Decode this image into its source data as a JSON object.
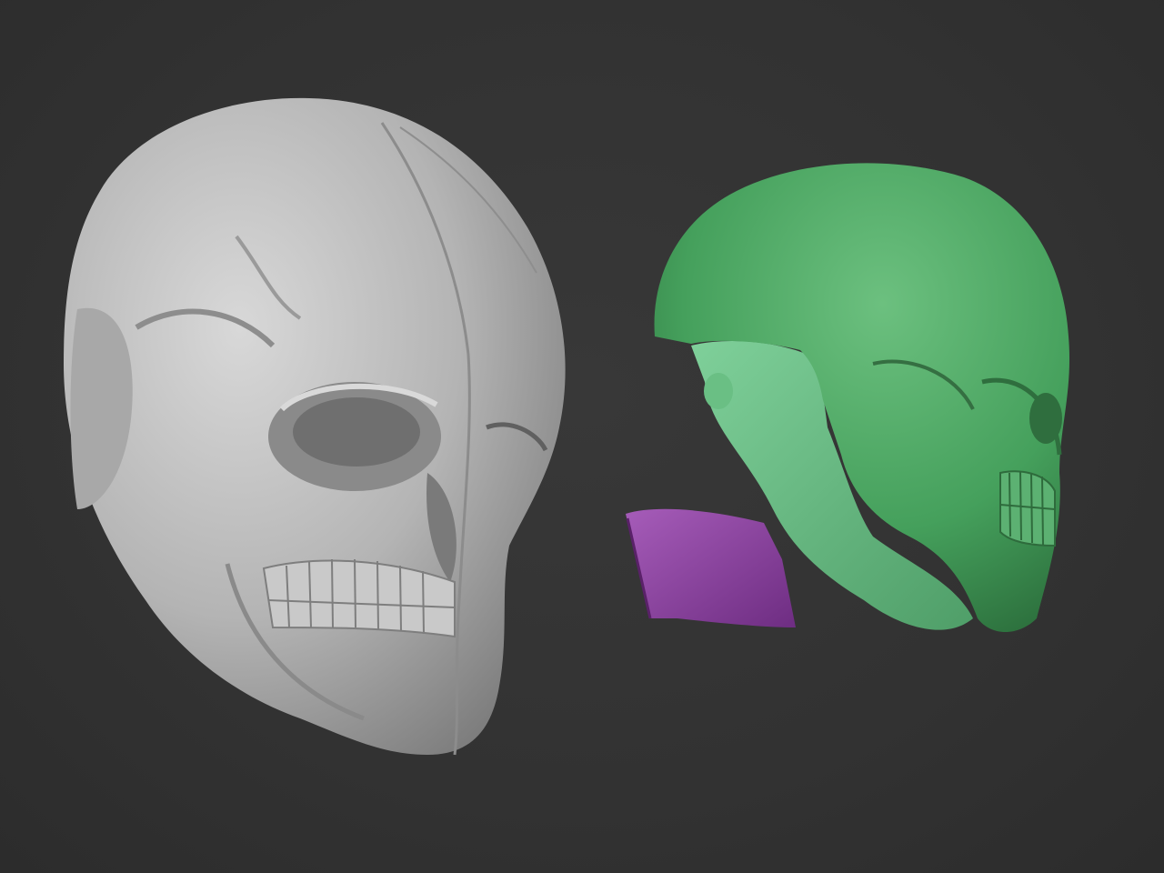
{
  "viewport": {
    "background_color": "#323232"
  },
  "models": [
    {
      "name": "skull-helmet-front-three-quarter",
      "material_color": "#b9b9b9"
    },
    {
      "name": "skull-helmet-side-profile",
      "material_color": "#4fa864"
    },
    {
      "name": "helmet-liner-interior",
      "material_color": "#6cc287"
    },
    {
      "name": "detached-panel-piece",
      "material_color": "#8e3ea3"
    }
  ]
}
